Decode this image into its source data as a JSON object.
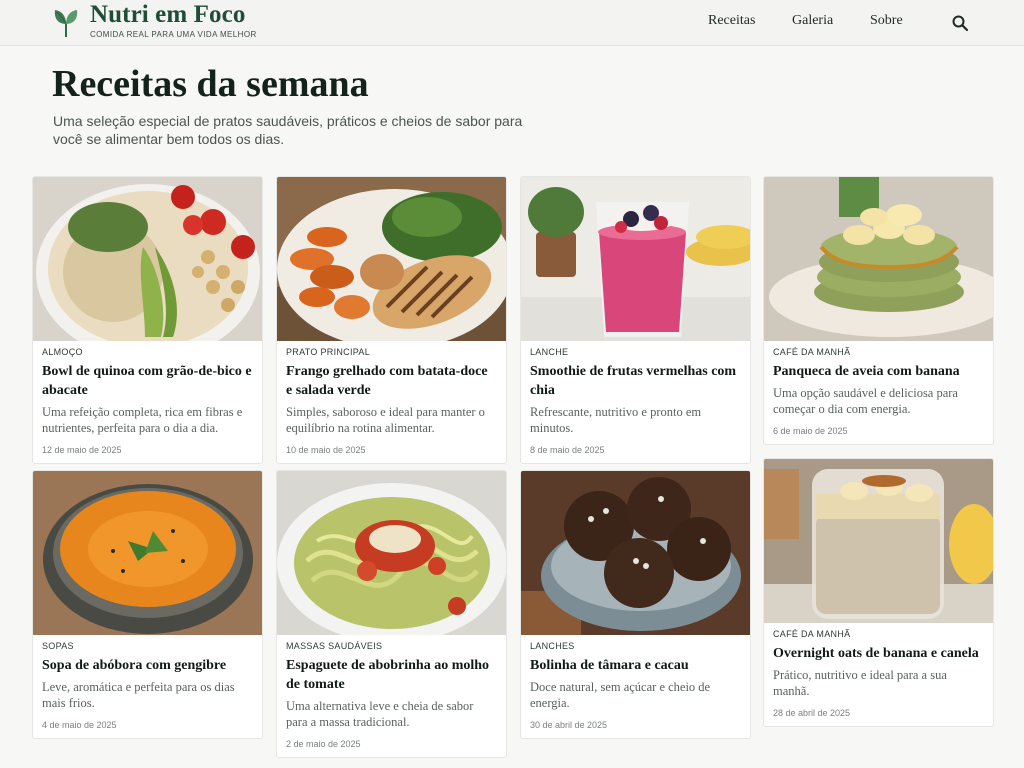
{
  "brand": {
    "name": "Nutri em Foco",
    "tagline": "COMIDA REAL PARA UMA VIDA MELHOR"
  },
  "nav": {
    "items": [
      "Receitas",
      "Galeria",
      "Sobre"
    ],
    "search_icon": "search-icon"
  },
  "hero": {
    "title": "Receitas da semana",
    "subtitle": "Uma seleção especial de pratos saudáveis, práticos e cheios de sabor para você se alimentar bem todos os dias."
  },
  "colors": {
    "brand_green": "#1f4d35",
    "leaf_green": "#3f7a52",
    "background": "#f7f7f6"
  },
  "recipes": [
    {
      "category": "ALMOÇO",
      "title": "Bowl de quinoa com grão-de-bico e abacate",
      "description": "Uma refeição completa, rica em fibras e nutrientes, perfeita para o dia a dia.",
      "date": "12 de maio de 2025"
    },
    {
      "category": "PRATO PRINCIPAL",
      "title": "Frango grelhado com batata-doce e salada verde",
      "description": "Simples, saboroso e ideal para manter o equilíbrio na rotina alimentar.",
      "date": "10 de maio de 2025"
    },
    {
      "category": "LANCHE",
      "title": "Smoothie de frutas vermelhas com chia",
      "description": "Refrescante, nutritivo e pronto em minutos.",
      "date": "8 de maio de 2025"
    },
    {
      "category": "CAFÉ DA MANHÃ",
      "title": "Panqueca de aveia com banana",
      "description": "Uma opção saudável e deliciosa para começar o dia com energia.",
      "date": "6 de maio de 2025"
    },
    {
      "category": "SOPAS",
      "title": "Sopa de abóbora com gengibre",
      "description": "Leve, aromática e perfeita para os dias mais frios.",
      "date": "4 de maio de 2025"
    },
    {
      "category": "MASSAS SAUDÁVEIS",
      "title": "Espaguete de abobrinha ao molho de tomate",
      "description": "Uma alternativa leve e cheia de sabor para a massa tradicional.",
      "date": "2 de maio de 2025"
    },
    {
      "category": "LANCHES",
      "title": "Bolinha de tâmara e cacau",
      "description": "Doce natural, sem açúcar e cheio de energia.",
      "date": "30 de abril de 2025"
    },
    {
      "category": "CAFÉ DA MANHÃ",
      "title": "Overnight oats de banana e canela",
      "description": "Prático, nutritivo e ideal para a sua manhã.",
      "date": "28 de abril de 2025"
    }
  ]
}
